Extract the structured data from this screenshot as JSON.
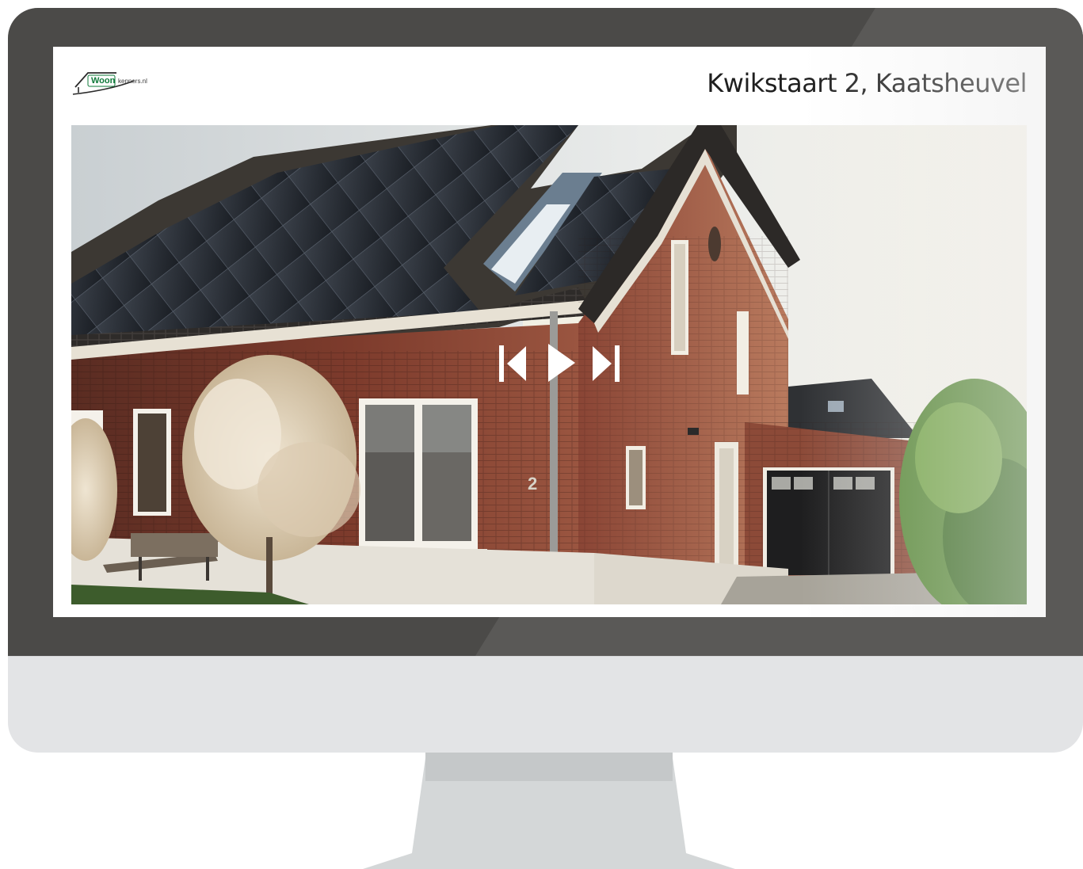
{
  "listing": {
    "title": "Kwikstaart 2, Kaatsheuvel",
    "house_number": "2"
  },
  "brand": {
    "name_part1": "Woon",
    "name_part2": "kenners.nl",
    "color": "#0f7a3a"
  },
  "media_controls": {
    "previous_icon": "skip-previous-icon",
    "play_icon": "play-icon",
    "next_icon": "skip-next-icon"
  },
  "colors": {
    "bezel": "#4b4a48",
    "chin": "#e3e4e6",
    "stand": "#d4d7d8"
  }
}
